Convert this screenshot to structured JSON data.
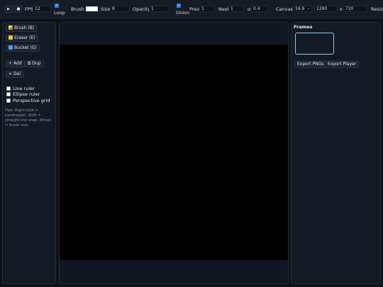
{
  "toolbar": {
    "play_icon": "▶",
    "stop_icon": "■",
    "fps_label": "FPS",
    "fps_value": "12",
    "loop_label": "Loop",
    "loop_checked": true,
    "brush_label": "Brush",
    "brush_color": "#ffffff",
    "size_label": "Size",
    "size_value": "8",
    "opacity_label": "Opacity",
    "opacity_value": "1",
    "onion_label": "Onion",
    "onion_checked": true,
    "prev_label": "Prev",
    "prev_value": "1",
    "next_label": "Next",
    "next_value": "1",
    "alpha_label": "α",
    "alpha_value": "0.4",
    "canvas_label": "Canvas",
    "ratio_value": "16:9",
    "width_value": "1280",
    "times": "×",
    "height_value": "720",
    "resize_label": "Resize"
  },
  "tools": {
    "brush": "Brush (B)",
    "eraser": "Eraser (E)",
    "bucket": "Bucket (G)",
    "add": "Add",
    "dup": "Dup",
    "del": "Del"
  },
  "rulers": [
    {
      "label": "Line ruler",
      "checked": false
    },
    {
      "label": "Ellipse ruler",
      "checked": false
    },
    {
      "label": "Perspective grid",
      "checked": false
    }
  ],
  "tips": "Tips: Right-click = eyedropper. Shift = straight-line snap. Wheel = brush size.",
  "frames": {
    "title": "Frames",
    "export_pngs": "Export PNGs",
    "export_player": "Export Player"
  },
  "colors": {
    "accent": "#2f7de1",
    "thumb_border": "#8fc2f0",
    "canvas": "#000000"
  }
}
